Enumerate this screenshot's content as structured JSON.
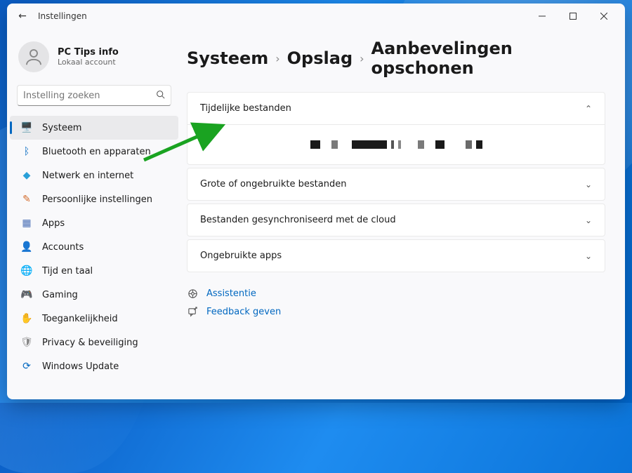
{
  "window": {
    "title": "Instellingen"
  },
  "user": {
    "name": "PC Tips info",
    "subtitle": "Lokaal account"
  },
  "search": {
    "placeholder": "Instelling zoeken"
  },
  "nav": [
    {
      "icon": "🖥️",
      "label": "Systeem",
      "active": true,
      "iconColor": "#3a7bd5"
    },
    {
      "icon": "ᛒ",
      "label": "Bluetooth en apparaten",
      "iconColor": "#0067c0"
    },
    {
      "icon": "◆",
      "label": "Netwerk en internet",
      "iconColor": "#2aa0d8"
    },
    {
      "icon": "✎",
      "label": "Persoonlijke instellingen",
      "iconColor": "#d26a2a"
    },
    {
      "icon": "▦",
      "label": "Apps",
      "iconColor": "#4a6fb5"
    },
    {
      "icon": "👤",
      "label": "Accounts",
      "iconColor": "#888"
    },
    {
      "icon": "🌐",
      "label": "Tijd en taal",
      "iconColor": "#2a8a9b"
    },
    {
      "icon": "🎮",
      "label": "Gaming",
      "iconColor": "#888"
    },
    {
      "icon": "✋",
      "label": "Toegankelijkheid",
      "iconColor": "#4a6fb5"
    },
    {
      "icon": "🛡",
      "label": "Privacy & beveiliging",
      "iconColor": "#888"
    },
    {
      "icon": "⟳",
      "label": "Windows Update",
      "iconColor": "#0067c0"
    }
  ],
  "breadcrumb": {
    "items": [
      "Systeem",
      "Opslag",
      "Aanbevelingen opschonen"
    ]
  },
  "sections": [
    {
      "label": "Tijdelijke bestanden",
      "expanded": true
    },
    {
      "label": "Grote of ongebruikte bestanden",
      "expanded": false
    },
    {
      "label": "Bestanden gesynchroniseerd met de cloud",
      "expanded": false
    },
    {
      "label": "Ongebruikte apps",
      "expanded": false
    }
  ],
  "redacted_blocks": [
    {
      "w": 14,
      "c": "#1a1a1a"
    },
    {
      "w": 4,
      "c": "transparent"
    },
    {
      "w": 9,
      "c": "#7a7a7a"
    },
    {
      "w": 8,
      "c": "transparent"
    },
    {
      "w": 50,
      "c": "#1a1a1a"
    },
    {
      "w": 4,
      "c": "#555"
    },
    {
      "w": 4,
      "c": "#888"
    },
    {
      "w": 12,
      "c": "transparent"
    },
    {
      "w": 9,
      "c": "#7a7a7a"
    },
    {
      "w": 4,
      "c": "transparent"
    },
    {
      "w": 13,
      "c": "#1a1a1a"
    },
    {
      "w": 18,
      "c": "transparent"
    },
    {
      "w": 9,
      "c": "#6a6a6a"
    },
    {
      "w": 9,
      "c": "#1a1a1a"
    }
  ],
  "footer_links": [
    {
      "icon": "support",
      "label": "Assistentie"
    },
    {
      "icon": "feedback",
      "label": "Feedback geven"
    }
  ]
}
